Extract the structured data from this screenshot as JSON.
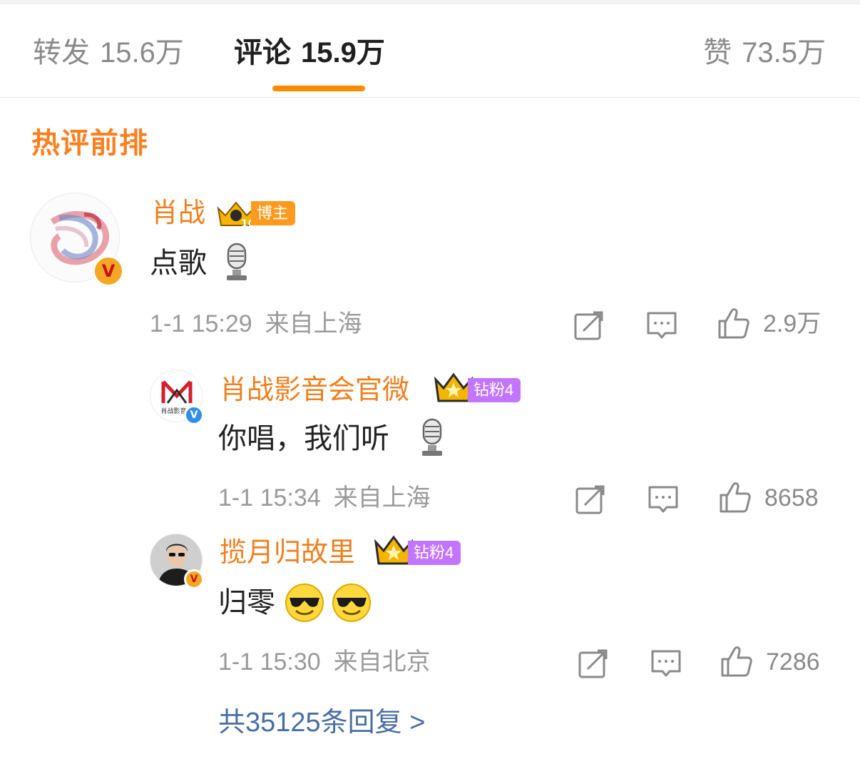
{
  "tabs": {
    "repost": {
      "label": "转发",
      "count": "15.6万"
    },
    "comment": {
      "label": "评论",
      "count": "15.9万"
    },
    "like": {
      "label": "赞",
      "count": "73.5万"
    }
  },
  "section_title": "热评前排",
  "colors": {
    "accent": "#ff8a00",
    "name": "#f07f1e",
    "link": "#4a6ea5",
    "fan_tag": "#c276ff"
  },
  "comment": {
    "author": "肖战",
    "author_tag": "博主",
    "crown_level": "10",
    "text": "点歌",
    "emoji": "microphone",
    "date": "1-1 15:29",
    "location": "来自上海",
    "likes": "2.9万"
  },
  "replies": [
    {
      "author": "肖战影音会官微",
      "fan_tag": "钻粉4",
      "avatar_text": "肖战影音会",
      "text": "你唱，我们听",
      "emoji": "microphone",
      "date": "1-1 15:34",
      "location": "来自上海",
      "likes": "8658"
    },
    {
      "author": "揽月归故里",
      "fan_tag": "钻粉4",
      "text": "归零",
      "emoji": "sunglasses",
      "date": "1-1 15:30",
      "location": "来自北京",
      "likes": "7286"
    }
  ],
  "more_replies": "共35125条回复 >"
}
